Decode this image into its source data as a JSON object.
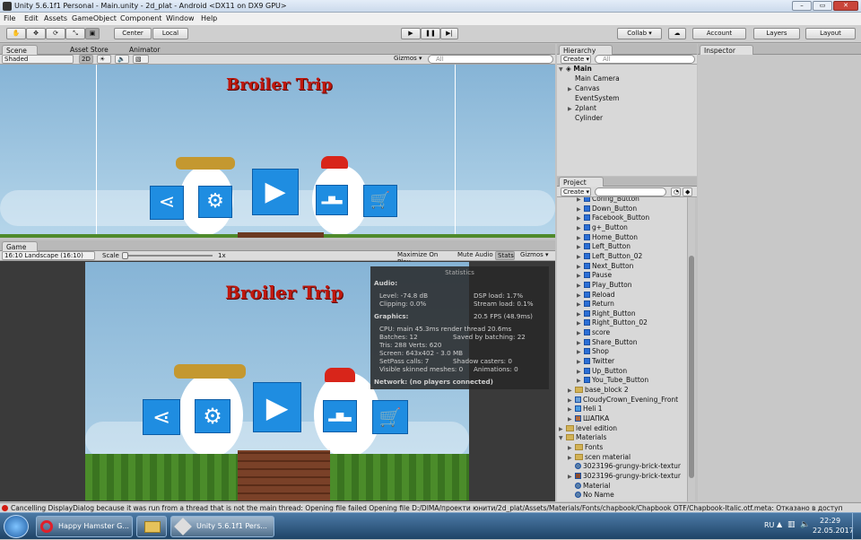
{
  "window": {
    "title": "Unity 5.6.1f1 Personal - Main.unity - 2d_plat - Android <DX11 on DX9 GPU>"
  },
  "menu": [
    "File",
    "Edit",
    "Assets",
    "GameObject",
    "Component",
    "Window",
    "Help"
  ],
  "toolbar": {
    "center": "Center",
    "local": "Local",
    "collab": "Collab ▾",
    "account": "Account",
    "layers": "Layers",
    "layout": "Layout"
  },
  "scene": {
    "tabs": [
      "Scene",
      "Asset Store",
      "Animator"
    ],
    "shaded": "Shaded",
    "mode2d": "2D",
    "gizmos": "Gizmos ▾",
    "search": "All"
  },
  "game_title": "Broiler Trip",
  "game": {
    "tab": "Game",
    "aspect": "16:10 Landscape (16:10)",
    "scale_label": "Scale",
    "scale_value": "1x",
    "maximize": "Maximize On Play",
    "mute": "Mute Audio",
    "stats": "Stats",
    "gizmos": "Gizmos ▾"
  },
  "stats": {
    "title": "Statistics",
    "audio": "Audio:",
    "level": "Level: -74.8 dB",
    "dsp": "DSP load: 1.7%",
    "clipping": "Clipping: 0.0%",
    "stream": "Stream load: 0.1%",
    "graphics": "Graphics:",
    "fps": "20.5 FPS (48.9ms)",
    "cpu": "CPU: main 45.3ms  render thread 20.6ms",
    "batches": "Batches: 12",
    "saved": "Saved by batching: 22",
    "tris": "Tris: 288  Verts: 620",
    "screen": "Screen: 643x402 - 3.0 MB",
    "setpass": "SetPass calls: 7",
    "shadow": "Shadow casters: 0",
    "skinned": "Visible skinned meshes: 0",
    "animations": "Animations: 0",
    "network": "Network: (no players connected)"
  },
  "hierarchy": {
    "tab": "Hierarchy",
    "create": "Create ▾",
    "search": "All",
    "scene": "Main",
    "items": [
      "Main Camera",
      "Canvas",
      "EventSystem",
      "2plant",
      "Cylinder"
    ]
  },
  "inspector": {
    "tab": "Inspector"
  },
  "project": {
    "tab": "Project",
    "create": "Create ▾",
    "items": [
      "Config_Button",
      "Down_Button",
      "Facebook_Button",
      "g+_Button",
      "Home_Button",
      "Left_Button",
      "Left_Button_02",
      "Next_Button",
      "Pause",
      "Play_Button",
      "Reload",
      "Return",
      "Right_Button",
      "Right_Button_02",
      "score",
      "Share_Button",
      "Shop",
      "Twitter",
      "Up_Button",
      "You_Tube_Button"
    ],
    "folders": [
      "base_block 2",
      "CloudyCrown_Evening_Front",
      "Heli 1",
      "ШАПКА",
      "level edition",
      "Materials",
      "Fonts",
      "scen material",
      "3023196-grungy-brick-textur",
      "3023196-grungy-brick-textur",
      "Material",
      "No Name"
    ]
  },
  "status": {
    "message": "Cancelling DisplayDialog because it was run from a thread that is not the main thread: Opening file failed Opening file D:/DIMA/проекти юнити/2d_plat/Assets/Materials/Fonts/chapbook/Chapbook OTF/Chapbook-Italic.otf.meta: Отказано в доступ"
  },
  "taskbar": {
    "task1": "Happy Hamster G...",
    "task2": "Unity 5.6.1f1 Pers...",
    "lang": "RU",
    "time": "22:29",
    "date": "22.05.2017"
  },
  "colors": {
    "accent": "#1f8de1",
    "title_red": "#c0180d",
    "error": "#d21a10"
  }
}
